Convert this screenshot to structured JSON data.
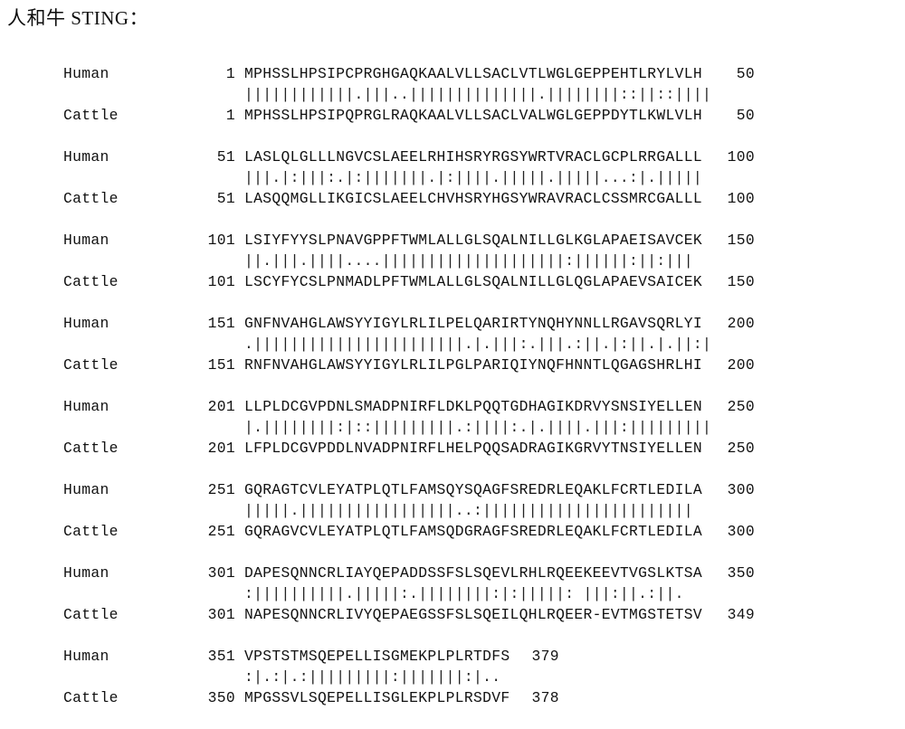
{
  "document": {
    "heading": "人和牛 STING："
  },
  "alignment": {
    "labels": {
      "query": "Human",
      "subject": "Cattle"
    },
    "blocks": [
      {
        "query_start": "1",
        "query_seq": "MPHSSLHPSIPCPRGHGAQKAALVLLSACLVTLWGLGEPPEHTLRYLVLH",
        "query_end": "50",
        "match": "||||||||||||.|||..||||||||||||||.||||||||::||::||||",
        "subject_start": "1",
        "subject_seq": "MPHSSLHPSIPQPRGLRAQKAALVLLSACLVALWGLGEPPDYTLKWLVLH",
        "subject_end": "50"
      },
      {
        "query_start": "51",
        "query_seq": "LASLQLGLLLNGVCSLAEELRHIHSRYRGSYWRTVRACLGCPLRRGALLL",
        "query_end": "100",
        "match": "|||.|:|||:.|:|||||||.|:||||.|||||.|||||...:|.|||||",
        "subject_start": "51",
        "subject_seq": "LASQQMGLLIKGICSLAEELCHVHSRYHGSYWRAVRACLCSSMRCGALLL",
        "subject_end": "100"
      },
      {
        "query_start": "101",
        "query_seq": "LSIYFYYSLPNAVGPPFTWMLALLGLSQALNILLGLKGLAPAEISAVCEK",
        "query_end": "150",
        "match": "||.|||.||||....||||||||||||||||||||:||||||:||:|||",
        "subject_start": "101",
        "subject_seq": "LSCYFYCSLPNMADLPFTWMLALLGLSQALNILLGLQGLAPAEVSAICEK",
        "subject_end": "150"
      },
      {
        "query_start": "151",
        "query_seq": "GNFNVAHGLAWSYYIGYLRLILPELQARIRTYNQHYNNLLRGAVSQRLYI",
        "query_end": "200",
        "match": ".|||||||||||||||||||||||.|.|||:.|||.:||.|:||.|.||:|",
        "subject_start": "151",
        "subject_seq": "RNFNVAHGLAWSYYIGYLRLILPGLPARIQIYNQFHNNTLQGAGSHRLHI",
        "subject_end": "200"
      },
      {
        "query_start": "201",
        "query_seq": "LLPLDCGVPDNLSMADPNIRFLDKLPQQTGDHAGIKDRVYSNSIYELLEN",
        "query_end": "250",
        "match": "|.||||||||:|::|||||||||.:||||:.|.||||.|||:|||||||||",
        "subject_start": "201",
        "subject_seq": "LFPLDCGVPDDLNVADPNIRFLHELPQQSADRAGIKGRVYTNSIYELLEN",
        "subject_end": "250"
      },
      {
        "query_start": "251",
        "query_seq": "GQRAGTCVLEYATPLQTLFAMSQYSQAGFSREDRLEQAKLFCRTLEDILA",
        "query_end": "300",
        "match": "|||||.|||||||||||||||||..:|||||||||||||||||||||||",
        "subject_start": "251",
        "subject_seq": "GQRAGVCVLEYATPLQTLFAMSQDGRAGFSREDRLEQAKLFCRTLEDILA",
        "subject_end": "300"
      },
      {
        "query_start": "301",
        "query_seq": "DAPESQNNCRLIAYQEPADDSSFSLSQEVLRHLRQEEKEEVTVGSLKTSA",
        "query_end": "350",
        "match": ":||||||||||.|||||:.||||||||:|:|||||: |||:||.:||.",
        "subject_start": "301",
        "subject_seq": "NAPESQNNCRLIVYQEPAEGSSFSLSQEILQHLRQEER-EVTMGSTETSV",
        "subject_end": "349"
      },
      {
        "query_start": "351",
        "query_seq": "VPSTSTMSQEPELLISGMEKPLPLRTDFS",
        "query_end": "379",
        "match": ":|.:|.:|||||||||:|||||||:|..",
        "subject_start": "350",
        "subject_seq": "MPGSSVLSQEPELLISGLEKPLPLRSDVF",
        "subject_end": "378"
      }
    ]
  }
}
